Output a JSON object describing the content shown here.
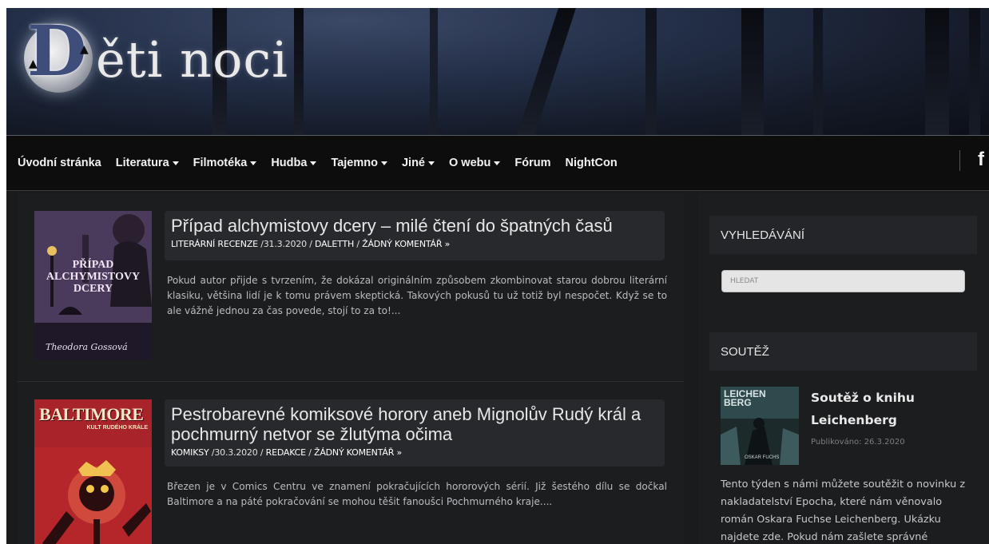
{
  "site": {
    "logo_initial": "D",
    "logo_text": "ěti noci"
  },
  "nav": {
    "items": [
      {
        "label": "Úvodní stránka",
        "dropdown": false
      },
      {
        "label": "Literatura",
        "dropdown": true
      },
      {
        "label": "Filmotéka",
        "dropdown": true
      },
      {
        "label": "Hudba",
        "dropdown": true
      },
      {
        "label": "Tajemno",
        "dropdown": true
      },
      {
        "label": "Jiné",
        "dropdown": true
      },
      {
        "label": "O webu",
        "dropdown": true
      },
      {
        "label": "Fórum",
        "dropdown": false
      },
      {
        "label": "NightCon",
        "dropdown": false
      }
    ],
    "social_icon": "facebook-icon",
    "social_glyph": "f"
  },
  "posts": [
    {
      "title": "Případ alchymistovy dcery – milé čtení do špatných časů",
      "category": "LITERÁRNÍ RECENZE",
      "date": "31.3.2020",
      "author": "DALETTH",
      "comments": "ŽÁDNÝ KOMENTÁŘ »",
      "excerpt": "Pokud autor přijde s tvrzením, že dokázal originálním způsobem zkombinovat starou dobrou literární klasiku, většina lidí je k tomu právem skeptická. Takových pokusů tu už totiž byl nespočet. Když se to ale vážně jednou za čas povede, stojí to za to!...",
      "thumb": {
        "title_line1": "PŘÍPAD",
        "title_line2": "ALCHYMISTOVY",
        "title_line3": "DCERY",
        "author": "Theodora Gossová"
      }
    },
    {
      "title": "Pestrobarevné komiksové horory aneb Mignolův Rudý král a pochmurný netvor se žlutýma očima",
      "category": "KOMIKSY",
      "date": "30.3.2020",
      "author": "REDAKCE",
      "comments": "ŽÁDNÝ KOMENTÁŘ »",
      "excerpt": "Březen je v Comics Centru ve znamení pokračujících hororových sérií. Již šestého dílu se dočkal Baltimore a na páté pokračování se mohou těšit fanoušci Pochmurného kraje....",
      "thumb": {
        "title": "BALTIMORE",
        "subtitle": "KULT RUDÉHO KRÁLE"
      }
    }
  ],
  "sidebar": {
    "search": {
      "heading": "VYHLEDÁVÁNÍ",
      "placeholder": "HLEDAT"
    },
    "contest": {
      "heading": "SOUTĚŽ",
      "title": "Soutěž o knihu Leichenberg",
      "date": "Publikováno: 26.3.2020",
      "text": "Tento týden s námi můžete soutěžit o novinku z nakladatelství Epocha, které nám věnovalo román Oskara Fuchse Leichenberg. Ukázku najdete zde. Pokud nám zašlete správné",
      "thumb": {
        "title": "LEICHEN BERG",
        "author": "OSKAR FUCHS"
      }
    }
  },
  "colors": {
    "background": "#1a1b1d",
    "nav_background": "#0d0d0d",
    "title_box": "#27292c",
    "widget_head": "#232528",
    "baltimore_red": "#b5262a",
    "alchemist_purple": "#7a5c8e"
  }
}
